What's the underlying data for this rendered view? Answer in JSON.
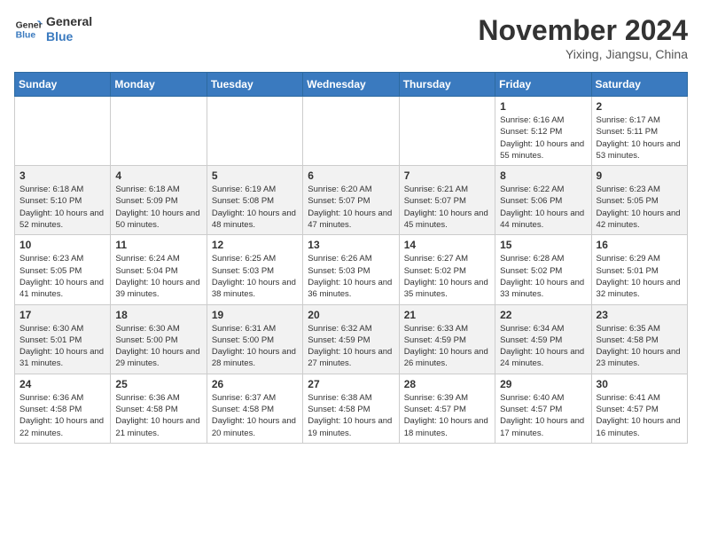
{
  "header": {
    "logo_line1": "General",
    "logo_line2": "Blue",
    "month": "November 2024",
    "location": "Yixing, Jiangsu, China"
  },
  "weekdays": [
    "Sunday",
    "Monday",
    "Tuesday",
    "Wednesday",
    "Thursday",
    "Friday",
    "Saturday"
  ],
  "weeks": [
    [
      {
        "day": "",
        "info": ""
      },
      {
        "day": "",
        "info": ""
      },
      {
        "day": "",
        "info": ""
      },
      {
        "day": "",
        "info": ""
      },
      {
        "day": "",
        "info": ""
      },
      {
        "day": "1",
        "info": "Sunrise: 6:16 AM\nSunset: 5:12 PM\nDaylight: 10 hours and 55 minutes."
      },
      {
        "day": "2",
        "info": "Sunrise: 6:17 AM\nSunset: 5:11 PM\nDaylight: 10 hours and 53 minutes."
      }
    ],
    [
      {
        "day": "3",
        "info": "Sunrise: 6:18 AM\nSunset: 5:10 PM\nDaylight: 10 hours and 52 minutes."
      },
      {
        "day": "4",
        "info": "Sunrise: 6:18 AM\nSunset: 5:09 PM\nDaylight: 10 hours and 50 minutes."
      },
      {
        "day": "5",
        "info": "Sunrise: 6:19 AM\nSunset: 5:08 PM\nDaylight: 10 hours and 48 minutes."
      },
      {
        "day": "6",
        "info": "Sunrise: 6:20 AM\nSunset: 5:07 PM\nDaylight: 10 hours and 47 minutes."
      },
      {
        "day": "7",
        "info": "Sunrise: 6:21 AM\nSunset: 5:07 PM\nDaylight: 10 hours and 45 minutes."
      },
      {
        "day": "8",
        "info": "Sunrise: 6:22 AM\nSunset: 5:06 PM\nDaylight: 10 hours and 44 minutes."
      },
      {
        "day": "9",
        "info": "Sunrise: 6:23 AM\nSunset: 5:05 PM\nDaylight: 10 hours and 42 minutes."
      }
    ],
    [
      {
        "day": "10",
        "info": "Sunrise: 6:23 AM\nSunset: 5:05 PM\nDaylight: 10 hours and 41 minutes."
      },
      {
        "day": "11",
        "info": "Sunrise: 6:24 AM\nSunset: 5:04 PM\nDaylight: 10 hours and 39 minutes."
      },
      {
        "day": "12",
        "info": "Sunrise: 6:25 AM\nSunset: 5:03 PM\nDaylight: 10 hours and 38 minutes."
      },
      {
        "day": "13",
        "info": "Sunrise: 6:26 AM\nSunset: 5:03 PM\nDaylight: 10 hours and 36 minutes."
      },
      {
        "day": "14",
        "info": "Sunrise: 6:27 AM\nSunset: 5:02 PM\nDaylight: 10 hours and 35 minutes."
      },
      {
        "day": "15",
        "info": "Sunrise: 6:28 AM\nSunset: 5:02 PM\nDaylight: 10 hours and 33 minutes."
      },
      {
        "day": "16",
        "info": "Sunrise: 6:29 AM\nSunset: 5:01 PM\nDaylight: 10 hours and 32 minutes."
      }
    ],
    [
      {
        "day": "17",
        "info": "Sunrise: 6:30 AM\nSunset: 5:01 PM\nDaylight: 10 hours and 31 minutes."
      },
      {
        "day": "18",
        "info": "Sunrise: 6:30 AM\nSunset: 5:00 PM\nDaylight: 10 hours and 29 minutes."
      },
      {
        "day": "19",
        "info": "Sunrise: 6:31 AM\nSunset: 5:00 PM\nDaylight: 10 hours and 28 minutes."
      },
      {
        "day": "20",
        "info": "Sunrise: 6:32 AM\nSunset: 4:59 PM\nDaylight: 10 hours and 27 minutes."
      },
      {
        "day": "21",
        "info": "Sunrise: 6:33 AM\nSunset: 4:59 PM\nDaylight: 10 hours and 26 minutes."
      },
      {
        "day": "22",
        "info": "Sunrise: 6:34 AM\nSunset: 4:59 PM\nDaylight: 10 hours and 24 minutes."
      },
      {
        "day": "23",
        "info": "Sunrise: 6:35 AM\nSunset: 4:58 PM\nDaylight: 10 hours and 23 minutes."
      }
    ],
    [
      {
        "day": "24",
        "info": "Sunrise: 6:36 AM\nSunset: 4:58 PM\nDaylight: 10 hours and 22 minutes."
      },
      {
        "day": "25",
        "info": "Sunrise: 6:36 AM\nSunset: 4:58 PM\nDaylight: 10 hours and 21 minutes."
      },
      {
        "day": "26",
        "info": "Sunrise: 6:37 AM\nSunset: 4:58 PM\nDaylight: 10 hours and 20 minutes."
      },
      {
        "day": "27",
        "info": "Sunrise: 6:38 AM\nSunset: 4:58 PM\nDaylight: 10 hours and 19 minutes."
      },
      {
        "day": "28",
        "info": "Sunrise: 6:39 AM\nSunset: 4:57 PM\nDaylight: 10 hours and 18 minutes."
      },
      {
        "day": "29",
        "info": "Sunrise: 6:40 AM\nSunset: 4:57 PM\nDaylight: 10 hours and 17 minutes."
      },
      {
        "day": "30",
        "info": "Sunrise: 6:41 AM\nSunset: 4:57 PM\nDaylight: 10 hours and 16 minutes."
      }
    ]
  ]
}
